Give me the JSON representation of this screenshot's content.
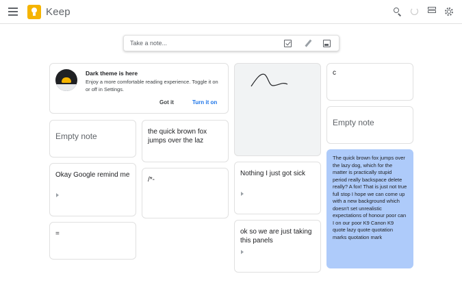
{
  "header": {
    "app_title": "Keep",
    "icons": [
      "menu-icon",
      "keep-logo",
      "search-icon",
      "refresh-icon",
      "list-view-icon",
      "gear-icon"
    ],
    "accent": "#f5b400"
  },
  "take_note": {
    "placeholder": "Take a note...",
    "icons": [
      "checkbox-icon",
      "pencil-icon",
      "image-icon"
    ]
  },
  "promo": {
    "title": "Dark theme is here",
    "body": "Enjoy a more comfortable reading experience. Toggle it on or off in Settings.",
    "dismiss_label": "Got it",
    "action_label": "Turn it on",
    "action_color": "#1a73e8"
  },
  "notes": {
    "empty_1": "Empty note",
    "fox": "the quick brown fox jumps over the laz",
    "drawing": "",
    "c": "c",
    "empty_2": "Empty note",
    "okay_google": "Okay Google remind me",
    "symbols": "/*-",
    "sick": "Nothing I just got sick",
    "long": "The quick brown fox jumps over the lazy dog, which for the matter is practically stupid period really backspace delete really? A fox! That is just not true full stop I hope we can come up with a new background which doesn't set unrealistic expectations of honour poor can I on our poor K9 Canon K9 quote lazy quote quotation marks quotation mark",
    "long_color": "#aecbfa",
    "equals": "=",
    "panels": "ok so we are just taking this panels"
  }
}
